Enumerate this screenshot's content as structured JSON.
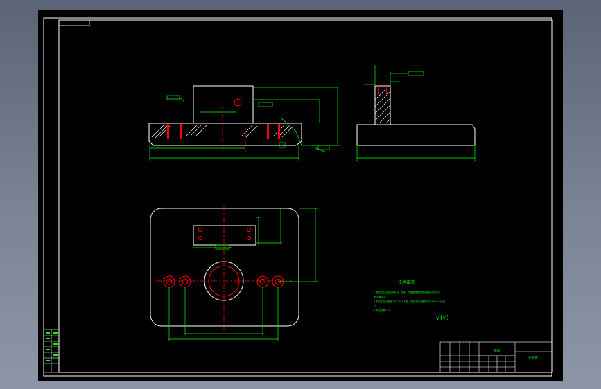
{
  "drawing": {
    "technical_requirements": {
      "title": "技术要求",
      "items": [
        "1.零件加工后应去除毛刺、锐边，并按图样要求进行检验后方可装",
        "配,表面清洁。",
        "2.未注形位公差按GB/T1184-K级，未注尺寸公差按GB/T1804-m级执",
        "行。",
        "3.未注倒角C0.5。"
      ]
    },
    "roughness_symbol": "√(√)",
    "title_block": {
      "part_name": "模板",
      "drawing_number": "夹具体"
    },
    "colors": {
      "background": "#000000",
      "outline": "#ffffff",
      "dimension": "#00ff00",
      "centerline": "#ff0000",
      "hatch": "#ffffff",
      "text": "#00ff00"
    }
  }
}
